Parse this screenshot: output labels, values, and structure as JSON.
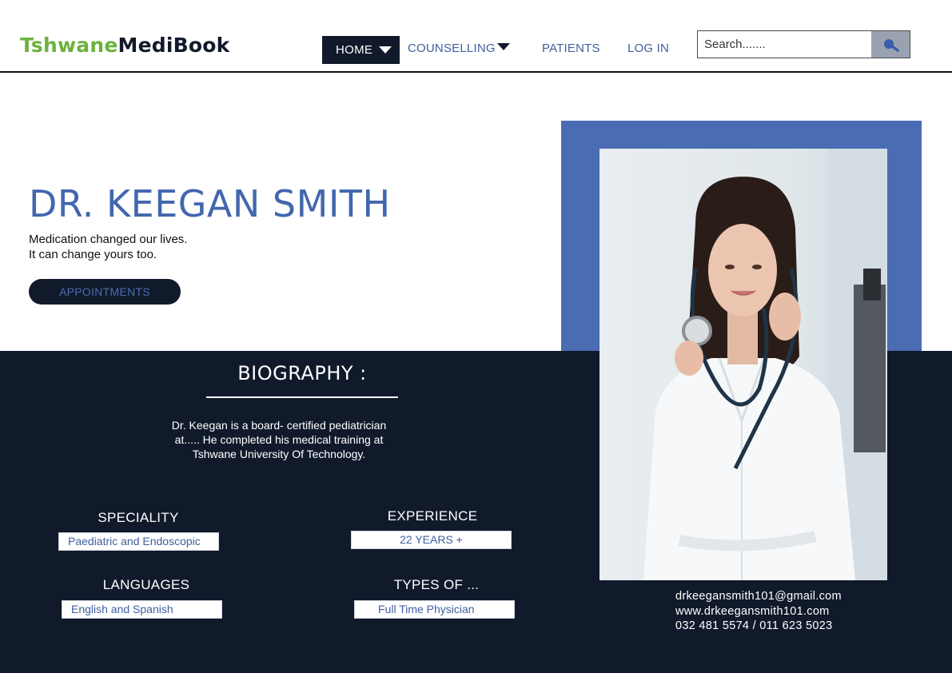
{
  "header": {
    "logo_part1": "Tshwane",
    "logo_part2": "MediBook",
    "nav": {
      "home": "HOME",
      "counselling": "COUNSELLING",
      "patients": "PATIENTS",
      "login": "LOG IN"
    },
    "search": {
      "placeholder": "Search......."
    }
  },
  "hero": {
    "name": "DR. KEEGAN SMITH",
    "tagline_line1": "Medication changed our lives.",
    "tagline_line2": "It can change yours too.",
    "appointments_label": "APPOINTMENTS"
  },
  "biography": {
    "title": "BIOGRAPHY :",
    "line1": "Dr. Keegan is a board- certified pediatrician",
    "line2": "at..... He completed his medical training at",
    "line3": "Tshwane University Of Technology."
  },
  "details": {
    "speciality": {
      "label": "SPECIALITY",
      "value": "Paediatric and Endoscopic"
    },
    "experience": {
      "label": "EXPERIENCE",
      "value": "22 YEARS +"
    },
    "languages": {
      "label": "LANGUAGES",
      "value": "English and Spanish"
    },
    "types": {
      "label": "TYPES OF ...",
      "value": "Full Time Physician"
    }
  },
  "contact": {
    "email": "drkeegansmith101@gmail.com",
    "website": "www.drkeegansmith101.com",
    "phones": "032 481 5574 / 011 623 5023"
  },
  "colors": {
    "brand_green": "#6bb23e",
    "navy": "#111a2b",
    "accent_blue": "#4a6cb3",
    "name_blue": "#4267ae"
  },
  "icons": {
    "search": "magnifier-icon",
    "dropdown": "triangle-down-icon"
  }
}
